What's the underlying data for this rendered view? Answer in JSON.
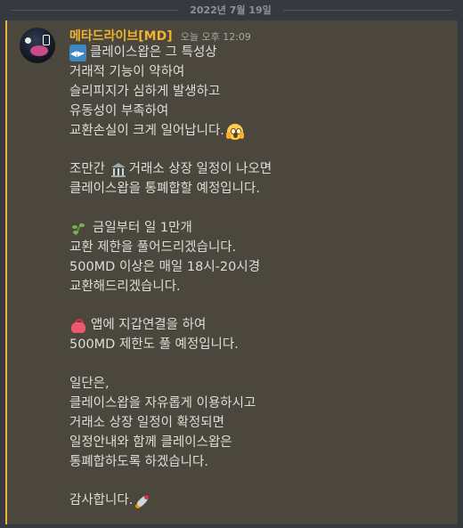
{
  "date_divider": "2022년 7월 19일",
  "message": {
    "author": "메타드라이브[MD]",
    "timestamp": "오늘 오후 12:09",
    "lines": [
      "클레이스왑은 그 특성상",
      "거래적 기능이 약하여",
      "슬리피지가 심하게 발생하고",
      "유동성이 부족하여",
      "교환손실이 크게 일어납니다.",
      "조만간 ",
      "거래소 상장 일정이 나오면",
      "클레이스왑을 통폐합할 예정입니다.",
      "금일부터 일 1만개",
      "교환 제한을 풀어드리겠습니다.",
      "500MD 이상은 매일 18시-20시경",
      "교환해드리겠습니다.",
      "앱에 지갑연결을 하여",
      "500MD 제한도 풀 예정입니다.",
      "일단은,",
      "클레이스왑을 자유롭게 이용하시고",
      "거래소 상장 일정이 확정되면",
      "일정안내와 함께 클레이스왑은",
      "통폐합하도록 하겠습니다.",
      "감사합니다."
    ]
  },
  "icons": {
    "avatar": "server-avatar",
    "emoji_1": "left-right-arrow-icon",
    "emoji_2": "scream-face-icon",
    "emoji_3": "classical-building-icon",
    "emoji_4": "herb-icon",
    "emoji_5": "purse-icon",
    "emoji_6": "rocket-icon"
  },
  "colors": {
    "background": "#36393f",
    "highlight": "#4b473c",
    "mention_bar": "#f0b232",
    "username": "#f0b232",
    "text": "#dcddde"
  }
}
